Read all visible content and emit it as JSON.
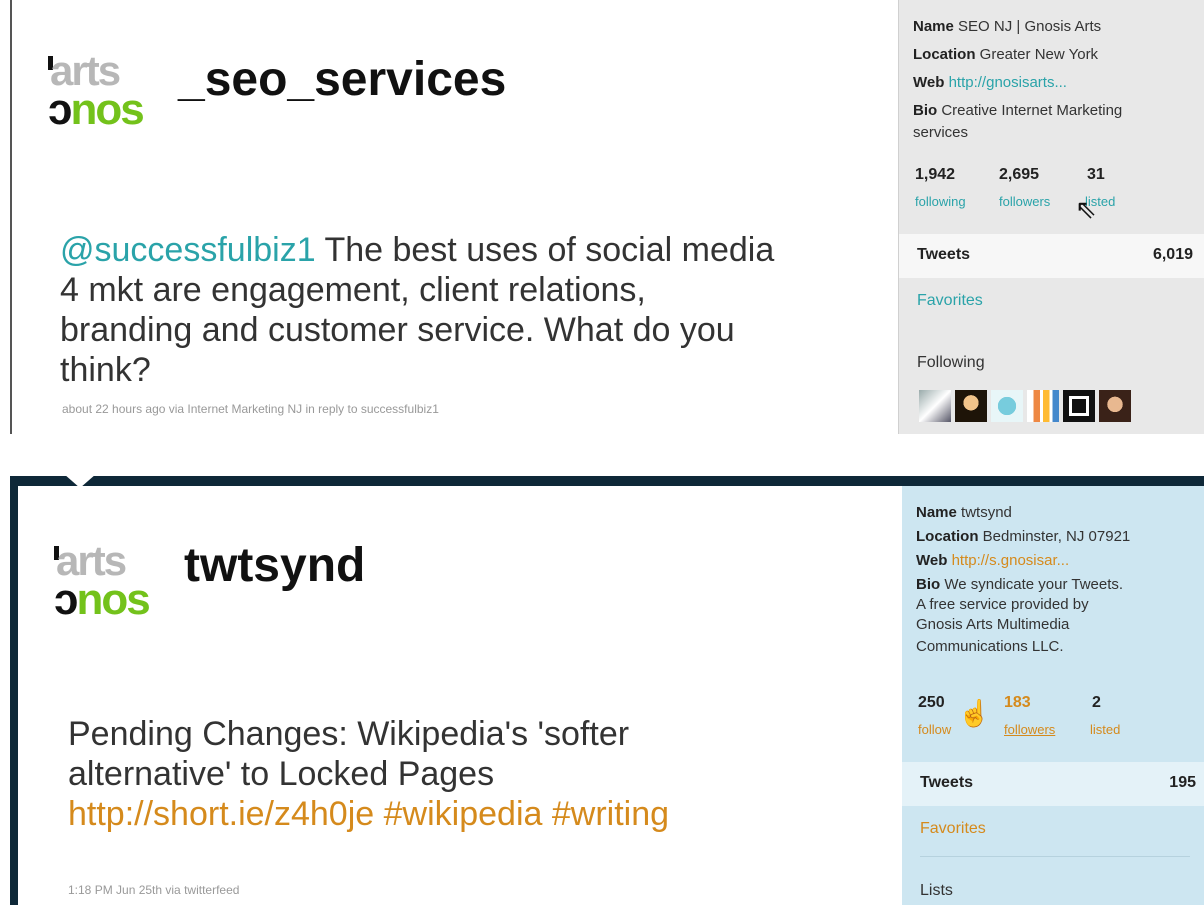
{
  "panels": [
    {
      "logo": {
        "top_word": "arts",
        "bottom_word_prefix": "ɔ",
        "bottom_word_rest": "nos"
      },
      "username": "_seo_services",
      "tweet": {
        "mention": "@successfulbiz1",
        "text": " The best uses of social media 4 mkt are engagement, client relations, branding and customer service. What do you think?"
      },
      "meta": "about 22 hours ago via Internet Marketing NJ in reply to successfulbiz1",
      "sidebar": {
        "name_label": "Name",
        "name_value": "SEO NJ | Gnosis Arts",
        "location_label": "Location",
        "location_value": "Greater New York",
        "web_label": "Web",
        "web_value": "http://gnosisarts...",
        "bio_label": "Bio",
        "bio_value_1": "Creative Internet Marketing",
        "bio_value_2": "services",
        "following_count": "1,942",
        "following_label": "following",
        "followers_count": "2,695",
        "followers_label": "followers",
        "listed_count": "31",
        "listed_label": "listed",
        "tweets_label": "Tweets",
        "tweets_count": "6,019",
        "favorites_label": "Favorites",
        "following_header": "Following"
      }
    },
    {
      "logo": {
        "top_word": "arts",
        "bottom_word_prefix": "ɔ",
        "bottom_word_rest": "nos"
      },
      "username": "twtsynd",
      "tweet": {
        "text": "Pending Changes: Wikipedia's 'softer alternative' to Locked Pages ",
        "link": "http://short.ie/z4h0je",
        "hashtag1": "#wikipedia",
        "hashtag2": "#writing"
      },
      "meta": "1:18 PM Jun 25th via twitterfeed",
      "sidebar": {
        "name_label": "Name",
        "name_value": "twtsynd",
        "location_label": "Location",
        "location_value": "Bedminster, NJ 07921",
        "web_label": "Web",
        "web_value": "http://s.gnosisar...",
        "bio_label": "Bio",
        "bio_value_1": "We syndicate your Tweets.",
        "bio_value_2": "A free service provided by",
        "bio_value_3": "Gnosis Arts Multimedia",
        "bio_value_4": "Communications LLC.",
        "following_count": "250",
        "following_label": "follow",
        "followers_count": "183",
        "followers_label": "followers",
        "listed_count": "2",
        "listed_label": "listed",
        "tweets_label": "Tweets",
        "tweets_count": "195",
        "favorites_label": "Favorites",
        "lists_label": "Lists"
      }
    }
  ],
  "colors": {
    "teal": "#2aa3a9",
    "orange": "#d58a1c",
    "green": "#73c21b",
    "dark_frame": "#0e2838",
    "sidebar_blue": "#cde6f1"
  }
}
